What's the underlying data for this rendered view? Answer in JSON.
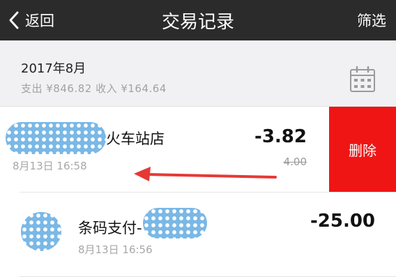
{
  "navbar": {
    "back_label": "返回",
    "title": "交易记录",
    "filter_label": "筛选",
    "background": "#2b2b2b"
  },
  "month_section": {
    "month": "2017年8月",
    "summary": "支出 ¥846.82 收入 ¥164.64",
    "calendar_icon": "calendar-icon"
  },
  "transactions": [
    {
      "merchant_suffix": "火车站店",
      "time": "8月13日 16:58",
      "amount": "-3.82",
      "original_amount": "4.00",
      "delete_label": "删除",
      "delete_color": "#f01515"
    },
    {
      "merchant_name": "条码支付-",
      "time": "8月13日 16:56",
      "amount": "-25.00"
    }
  ],
  "annotation": {
    "arrow_icon": "swipe-left-arrow-icon",
    "arrow_color": "#e53935"
  }
}
